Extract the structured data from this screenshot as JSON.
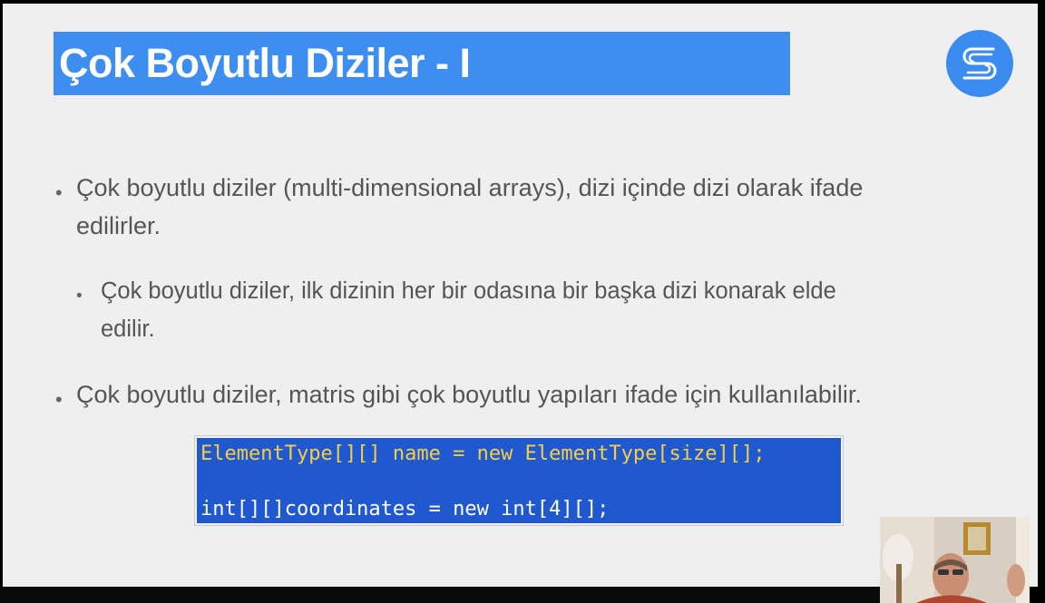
{
  "slide": {
    "title": "Çok Boyutlu Diziler - I",
    "logo_icon": "stream-s-logo-icon",
    "bullets": [
      {
        "level": 1,
        "lines": [
          "Çok boyutlu diziler (multi-dimensional arrays), dizi içinde dizi olarak ifade",
          "edilirler."
        ]
      },
      {
        "level": 2,
        "lines": [
          "Çok boyutlu diziler, ilk dizinin her bir odasına bir başka dizi konarak elde",
          "edilir."
        ]
      },
      {
        "level": 1,
        "lines": [
          "Çok boyutlu diziler, matris gibi çok boyutlu yapıları ifade için kullanılabilir."
        ]
      }
    ],
    "bullet_glyph": "•",
    "code": {
      "line1": "ElementType[][] name = new ElementType[size][];",
      "line2": "int[][]coordinates = new int[4][];"
    }
  },
  "colors": {
    "title_bg": "#3d8ef0",
    "code_bg": "#2058cf",
    "code_highlight": "#f4cf45",
    "body_text": "#555555"
  }
}
